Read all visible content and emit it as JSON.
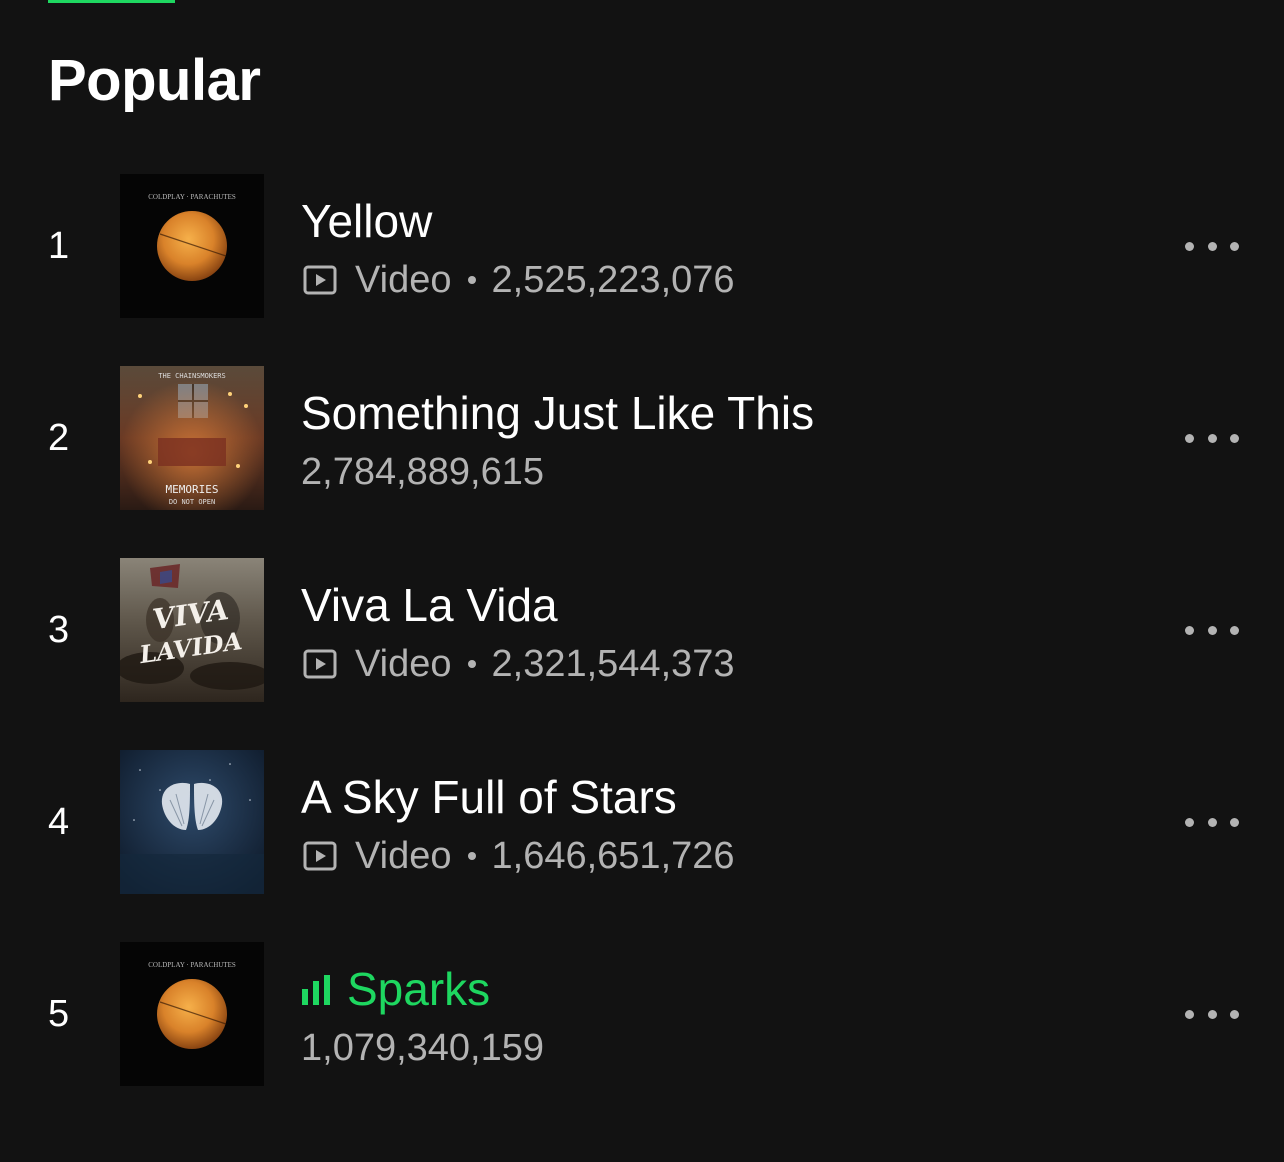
{
  "section": {
    "title": "Popular"
  },
  "colors": {
    "background": "#121212",
    "accent": "#1ed760",
    "secondary_text": "#b3b3b3"
  },
  "tracks": [
    {
      "number": "1",
      "title": "Yellow",
      "has_video": true,
      "video_label": "Video",
      "plays": "2,525,223,076",
      "cover_text": "COLDPLAY · PARACHUTES",
      "cover_icon": "moon-cover-icon",
      "playing": false
    },
    {
      "number": "2",
      "title": "Something Just Like This",
      "has_video": false,
      "plays": "2,784,889,615",
      "cover_text": "THE CHAINSMOKERS",
      "cover_text_2": "MEMORIES",
      "cover_text_3": "DO NOT OPEN",
      "cover_icon": "room-cover-icon",
      "playing": false
    },
    {
      "number": "3",
      "title": "Viva La Vida",
      "has_video": true,
      "video_label": "Video",
      "plays": "2,321,544,373",
      "cover_text": "VIVA LA VIDA",
      "cover_icon": "painting-cover-icon",
      "playing": false
    },
    {
      "number": "4",
      "title": "A Sky Full of Stars",
      "has_video": true,
      "video_label": "Video",
      "plays": "1,646,651,726",
      "cover_icon": "wings-cover-icon",
      "playing": false
    },
    {
      "number": "5",
      "title": "Sparks",
      "has_video": false,
      "plays": "1,079,340,159",
      "cover_text": "COLDPLAY · PARACHUTES",
      "cover_icon": "moon-cover-icon",
      "playing": true,
      "playing_icon": "equalizer-icon"
    }
  ]
}
